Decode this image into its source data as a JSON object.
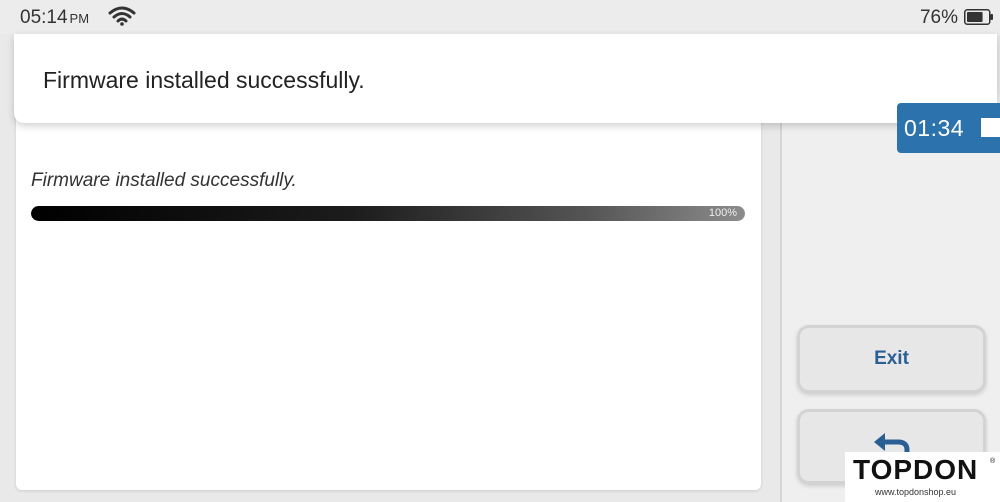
{
  "status_bar": {
    "time": "05:14",
    "ampm": "PM",
    "wifi_icon": "wifi-icon",
    "battery_percent": "76%",
    "battery_icon": "battery-icon",
    "battery_level": 0.76
  },
  "toast": {
    "message": "Firmware installed successfully."
  },
  "main": {
    "message": "Firmware installed successfully.",
    "progress": {
      "value": 1.0,
      "label": "100%"
    }
  },
  "timer": {
    "time": "01:34",
    "stop_icon": "stop-icon"
  },
  "buttons": {
    "exit_label": "Exit",
    "back_icon": "back-arrow-icon"
  },
  "watermark": {
    "brand": "TOPDON",
    "reg_mark": "®",
    "url": "www.topdonshop.eu"
  },
  "colors": {
    "accent": "#2c72ad",
    "button_text": "#2a5f93",
    "background": "#e9e9e9"
  }
}
